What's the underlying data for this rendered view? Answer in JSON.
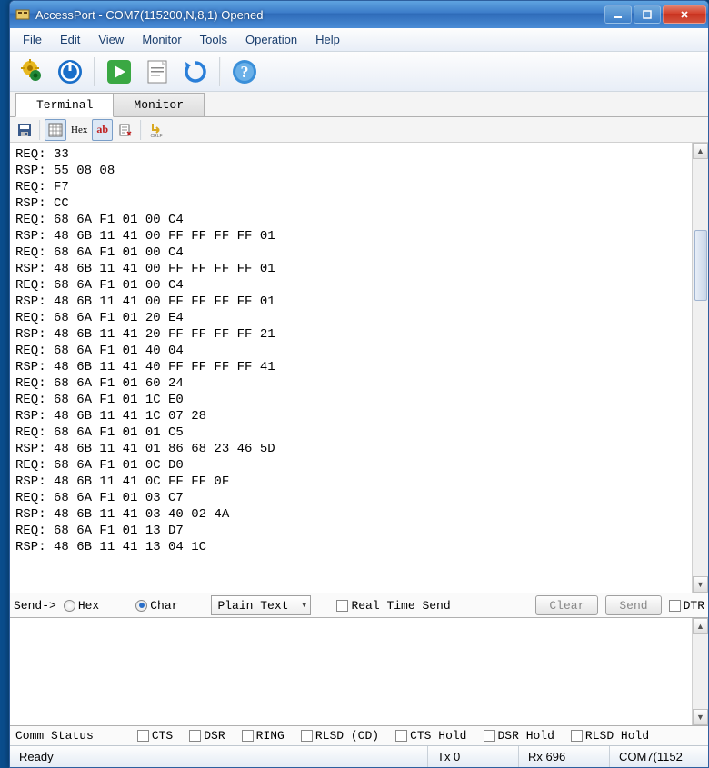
{
  "title": "AccessPort - COM7(115200,N,8,1) Opened",
  "menu": [
    "File",
    "Edit",
    "View",
    "Monitor",
    "Tools",
    "Operation",
    "Help"
  ],
  "tabs": {
    "terminal": "Terminal",
    "monitor": "Monitor"
  },
  "sub_toolbar": {
    "hex": "Hex",
    "ab": "ab"
  },
  "terminal_lines": [
    "REQ: 33",
    "RSP: 55 08 08",
    "REQ: F7",
    "RSP: CC",
    "REQ: 68 6A F1 01 00 C4",
    "RSP: 48 6B 11 41 00 FF FF FF FF 01",
    "REQ: 68 6A F1 01 00 C4",
    "RSP: 48 6B 11 41 00 FF FF FF FF 01",
    "REQ: 68 6A F1 01 00 C4",
    "RSP: 48 6B 11 41 00 FF FF FF FF 01",
    "REQ: 68 6A F1 01 20 E4",
    "RSP: 48 6B 11 41 20 FF FF FF FF 21",
    "REQ: 68 6A F1 01 40 04",
    "RSP: 48 6B 11 41 40 FF FF FF FF 41",
    "REQ: 68 6A F1 01 60 24",
    "REQ: 68 6A F1 01 1C E0",
    "RSP: 48 6B 11 41 1C 07 28",
    "REQ: 68 6A F1 01 01 C5",
    "RSP: 48 6B 11 41 01 86 68 23 46 5D",
    "REQ: 68 6A F1 01 0C D0",
    "RSP: 48 6B 11 41 0C FF FF 0F",
    "REQ: 68 6A F1 01 03 C7",
    "RSP: 48 6B 11 41 03 40 02 4A",
    "REQ: 68 6A F1 01 13 D7",
    "RSP: 48 6B 11 41 13 04 1C"
  ],
  "send": {
    "label": "Send->",
    "hex": "Hex",
    "char": "Char",
    "mode": "Plain Text",
    "realtime": "Real Time Send",
    "clear": "Clear",
    "send_btn": "Send",
    "dtr": "DTR"
  },
  "comm": {
    "label": "Comm Status",
    "items": [
      "CTS",
      "DSR",
      "RING",
      "RLSD (CD)",
      "CTS Hold",
      "DSR Hold",
      "RLSD Hold"
    ]
  },
  "status": {
    "ready": "Ready",
    "tx": "Tx 0",
    "rx": "Rx 696",
    "port": "COM7(1152"
  }
}
